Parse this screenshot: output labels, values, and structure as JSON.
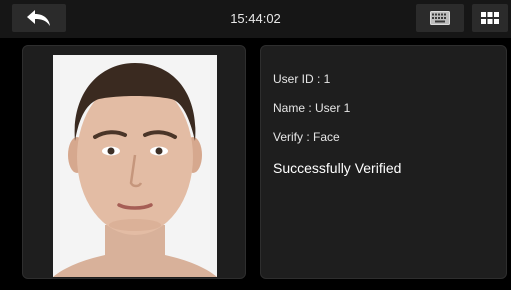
{
  "topbar": {
    "time": "15:44:02",
    "back_icon": "back-arrow-icon",
    "keyboard_icon": "keyboard-icon",
    "menu_icon": "grid-menu-icon"
  },
  "verification": {
    "user_id": "User ID : 1",
    "name": "Name : User 1",
    "verify": "Verify : Face",
    "status": "Successfully Verified"
  },
  "colors": {
    "background": "#000000",
    "bar": "#161616",
    "button": "#2b2b2b",
    "panel": "#1e1e1e"
  }
}
